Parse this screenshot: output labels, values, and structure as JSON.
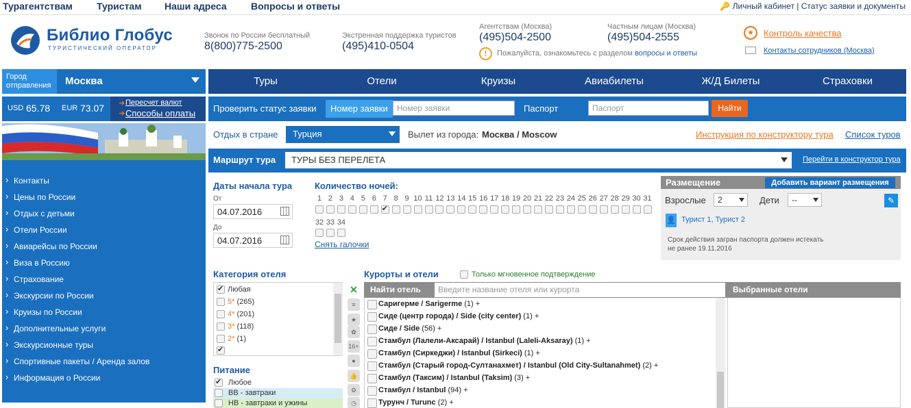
{
  "topnav": {
    "items": [
      "Турагентствам",
      "Туристам",
      "Наши адреса",
      "Вопросы и ответы"
    ],
    "cabinet": "Личный кабинет",
    "status": "Статус заявки и документы"
  },
  "logo": {
    "title": "Библио Глобус",
    "subtitle": "ТУРИСТИЧЕСКИЙ ОПЕРАТОР"
  },
  "contacts": {
    "free_label": "Звонок по России бесплатный",
    "free_phone": "8(800)775-2500",
    "support_label": "Экстренная поддержка туристов",
    "support_phone": "(495)410-0504",
    "agency_label": "Агентствам (Москва)",
    "agency_phone": "(495)504-2500",
    "private_label": "Частным лицам (Москва)",
    "private_phone": "(495)504-2555",
    "notice": "Пожалуйста, ознакомьтесь с разделом",
    "notice_link": "вопросы и ответы",
    "quality": "Контроль качества",
    "staff": "Контакты сотрудников (Москва)"
  },
  "city": {
    "label_line1": "Город",
    "label_line2": "отправления",
    "name": "Москва"
  },
  "currency": {
    "usd_label": "USD",
    "usd": "65.78",
    "eur_label": "EUR",
    "eur": "73.07",
    "recalc": "Пересчет валют",
    "payment": "Способы оплаты"
  },
  "sidemenu": [
    "Контакты",
    "Цены по России",
    "Отдых с детьми",
    "Отели России",
    "Авиарейсы по России",
    "Виза в Россию",
    "Страхование",
    "Экскурсии по России",
    "Круизы по России",
    "Дополнительные услуги",
    "Экскурсионные туры",
    "Спортивные пакеты / Аренда залов",
    "Информация о России"
  ],
  "mainnav": [
    "Туры",
    "Отели",
    "Круизы",
    "Авиабилеты",
    "Ж/Д Билеты",
    "Страховки"
  ],
  "status_check": {
    "label": "Проверить статус заявки",
    "order_label": "Номер заявки",
    "order_placeholder": "Номер заявки",
    "passport_label": "Паспорт",
    "passport_placeholder": "Паспорт",
    "find": "Найти"
  },
  "country": {
    "label": "Отдых в стране",
    "value": "Турция",
    "departure_label": "Вылет из города:",
    "departure": "Москва / Moscow",
    "instr": "Инструкция по конструктору тура",
    "list": "Список туров"
  },
  "route": {
    "label": "Маршрут тура",
    "value": "ТУРЫ БЕЗ ПЕРЕЛЕТА",
    "constructor": "Перейти в конструктор тура"
  },
  "dates": {
    "title": "Даты начала тура",
    "from_label": "От",
    "from": "04.07.2016",
    "to_label": "До",
    "to": "04.07.2016"
  },
  "nights": {
    "title": "Количество ночей:",
    "row1": [
      "1",
      "2",
      "3",
      "4",
      "5",
      "6",
      "7",
      "8",
      "9",
      "10",
      "11",
      "12",
      "13",
      "14",
      "15",
      "16",
      "17",
      "18",
      "19",
      "20",
      "21",
      "22",
      "23",
      "24",
      "25",
      "26",
      "27",
      "28",
      "29",
      "30",
      "31"
    ],
    "row2": [
      "32",
      "33",
      "34"
    ],
    "checked": "7",
    "clear": "Снять галочки"
  },
  "placement": {
    "title": "Размещение",
    "add": "Добавить вариант размещения",
    "adults_label": "Взрослые",
    "adults": "2",
    "kids_label": "Дети",
    "kids": "--",
    "tourists": "Турист 1, Турист 2",
    "passport_note1": "Срок действия загран паспорта должен истекать",
    "passport_note2": "не ранее 19.11.2016"
  },
  "category": {
    "title": "Категория отеля",
    "rows": [
      {
        "label": "Любая",
        "stars": "",
        "count": ""
      },
      {
        "label": "",
        "stars": "5*",
        "count": "(265)"
      },
      {
        "label": "",
        "stars": "4*",
        "count": "(201)"
      },
      {
        "label": "",
        "stars": "3*",
        "count": "(118)"
      },
      {
        "label": "",
        "stars": "2*",
        "count": "(1)"
      }
    ]
  },
  "meal": {
    "title": "Питание",
    "rows": [
      "Любое",
      "BB - завтраки",
      "HB - завтраки и ужины"
    ]
  },
  "resorts": {
    "title": "Курорты и отели",
    "instant": "Только мгновенное подтверждение",
    "find_hotel": "Найти отель",
    "placeholder": "Введите название отеля или курорта",
    "selected": "Выбранные отели",
    "items": [
      {
        "name": "Саригерме / Sarigerme",
        "count": "(1)"
      },
      {
        "name": "Сиде (центр города) / Side (city center)",
        "count": "(1)"
      },
      {
        "name": "Сиде / Side",
        "count": "(56)"
      },
      {
        "name": "Стамбул (Лалели-Аксарай) / Istanbul (Laleli-Aksaray)",
        "count": "(1)"
      },
      {
        "name": "Стамбул (Сиркеджи) / Istanbul (Sirkeci)",
        "count": "(1)"
      },
      {
        "name": "Стамбул (Старый город-Султанахмет) / Istanbul (Old City-Sultanahmet)",
        "count": "(2)"
      },
      {
        "name": "Стамбул (Таксим) / Istanbul (Taksim)",
        "count": "(3)"
      },
      {
        "name": "Стамбул / Istanbul",
        "count": "(94)"
      },
      {
        "name": "Турунч / Turunc",
        "count": "(2)"
      }
    ]
  },
  "colors": {
    "brand": "#1a6fbf",
    "navy": "#1b4a8e",
    "orange": "#e87722"
  }
}
